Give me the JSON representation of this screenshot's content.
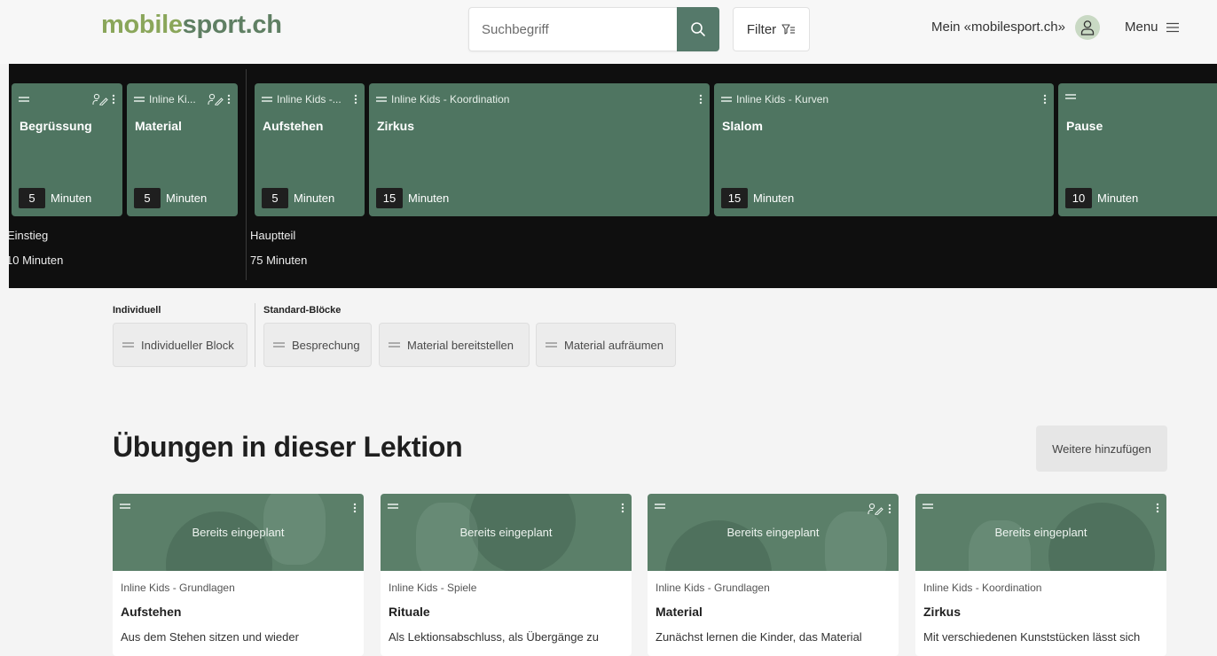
{
  "header": {
    "logo_part1": "mobile",
    "logo_part2": "sport.ch",
    "search_placeholder": "Suchbegriff",
    "filter_label": "Filter",
    "account_label": "Mein «mobilesport.ch»",
    "menu_label": "Menu"
  },
  "timeline": {
    "blocks": [
      {
        "label": "",
        "title": "Begrüssung",
        "minutes": "5",
        "unit": "Minuten",
        "user_icon": true
      },
      {
        "label": "Inline Ki...",
        "title": "Material",
        "minutes": "5",
        "unit": "Minuten",
        "user_icon": true
      },
      {
        "label": "Inline Kids -...",
        "title": "Aufstehen",
        "minutes": "5",
        "unit": "Minuten",
        "user_icon": false
      },
      {
        "label": "Inline Kids - Koordination",
        "title": "Zirkus",
        "minutes": "15",
        "unit": "Minuten",
        "user_icon": false
      },
      {
        "label": "Inline Kids - Kurven",
        "title": "Slalom",
        "minutes": "15",
        "unit": "Minuten",
        "user_icon": false
      },
      {
        "label": "",
        "title": "Pause",
        "minutes": "10",
        "unit": "Minuten",
        "user_icon": false
      }
    ],
    "phases": [
      {
        "name": "Einstieg",
        "duration": "10 Minuten"
      },
      {
        "name": "Hauptteil",
        "duration": "75 Minuten"
      }
    ]
  },
  "palette": {
    "individual_heading": "Individuell",
    "standard_heading": "Standard-Blöcke",
    "chips": [
      "Individueller Block",
      "Besprechung",
      "Material bereitstellen",
      "Material aufräumen"
    ]
  },
  "section": {
    "title": "Übungen in dieser Lektion",
    "add_more": "Weitere hinzufügen"
  },
  "cards": [
    {
      "status": "Bereits eingeplant",
      "category": "Inline Kids - Grundlagen",
      "title": "Aufstehen",
      "description": "Aus dem Stehen sitzen und wieder",
      "user_icon": false
    },
    {
      "status": "Bereits eingeplant",
      "category": "Inline Kids - Spiele",
      "title": "Rituale",
      "description": "Als Lektionsabschluss, als Übergänge zu",
      "user_icon": false
    },
    {
      "status": "Bereits eingeplant",
      "category": "Inline Kids - Grundlagen",
      "title": "Material",
      "description": "Zunächst lernen die Kinder, das Material",
      "user_icon": true
    },
    {
      "status": "Bereits eingeplant",
      "category": "Inline Kids - Koordination",
      "title": "Zirkus",
      "description": "Mit verschiedenen Kunststücken lässt sich",
      "user_icon": false
    }
  ],
  "colors": {
    "brand_green": "#8aa65a",
    "block_green": "#4f7561",
    "search_button": "#55796a",
    "timeline_bg": "#0f0f0f"
  }
}
